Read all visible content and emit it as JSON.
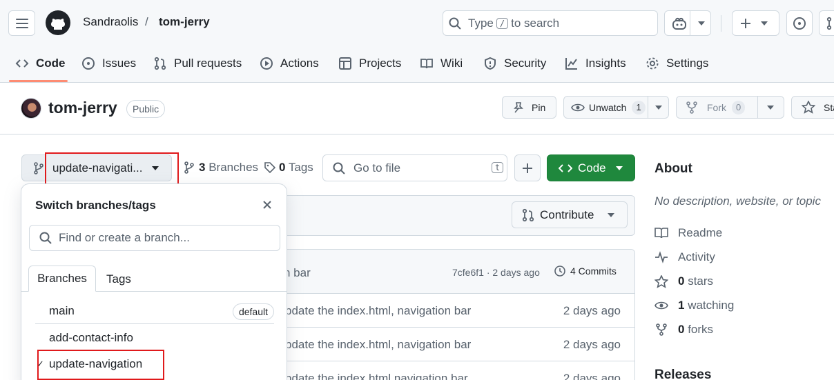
{
  "header": {
    "owner": "Sandraolis",
    "separator": "/",
    "repo": "tom-jerry",
    "search_prefix": "Type",
    "search_key": "/",
    "search_suffix": "to search"
  },
  "nav_tabs": [
    {
      "label": "Code",
      "icon": "code-icon"
    },
    {
      "label": "Issues",
      "icon": "issue-icon"
    },
    {
      "label": "Pull requests",
      "icon": "pull-request-icon"
    },
    {
      "label": "Actions",
      "icon": "play-icon"
    },
    {
      "label": "Projects",
      "icon": "table-icon"
    },
    {
      "label": "Wiki",
      "icon": "book-icon"
    },
    {
      "label": "Security",
      "icon": "shield-icon"
    },
    {
      "label": "Insights",
      "icon": "graph-icon"
    },
    {
      "label": "Settings",
      "icon": "gear-icon"
    }
  ],
  "repo_head": {
    "title": "tom-jerry",
    "visibility": "Public",
    "pin_label": "Pin",
    "unwatch_label": "Unwatch",
    "watch_count": "1",
    "fork_label": "Fork",
    "fork_count": "0",
    "star_label": "Sta"
  },
  "toolbar": {
    "branch_label": "update-navigati...",
    "branches_count": "3",
    "branches_label": "Branches",
    "tags_count": "0",
    "tags_label": "Tags",
    "goto_placeholder": "Go to file",
    "goto_key": "t",
    "code_label": "Code"
  },
  "main": {
    "contribute_label": "Contribute",
    "last_commit_msg": "n bar",
    "last_commit_sha": "7cfe6f1 · 2 days ago",
    "commits_label": "4 Commits",
    "rows": [
      {
        "message": "pdate the index.html, navigation bar",
        "age": "2 days ago"
      },
      {
        "message": "pdate the index.html, navigation bar",
        "age": "2 days ago"
      },
      {
        "message": "pdate the index.html navigation bar",
        "age": "2 days ago"
      }
    ]
  },
  "about": {
    "title": "About",
    "description": "No description, website, or topic",
    "readme": "Readme",
    "activity": "Activity",
    "stars_count": "0",
    "stars_label": "stars",
    "watching_count": "1",
    "watching_label": "watching",
    "forks_count": "0",
    "forks_label": "forks",
    "releases_title": "Releases"
  },
  "dropdown": {
    "title": "Switch branches/tags",
    "filter_placeholder": "Find or create a branch...",
    "tab_branches": "Branches",
    "tab_tags": "Tags",
    "branches": [
      {
        "name": "main",
        "badge": "default",
        "selected": false
      },
      {
        "name": "add-contact-info",
        "badge": "",
        "selected": false
      },
      {
        "name": "update-navigation",
        "badge": "",
        "selected": true
      }
    ],
    "check_mark": "✓"
  },
  "colors": {
    "primary_green": "#1f883d",
    "accent_underline": "#fd8c73",
    "highlight_box": "#e0191b"
  }
}
